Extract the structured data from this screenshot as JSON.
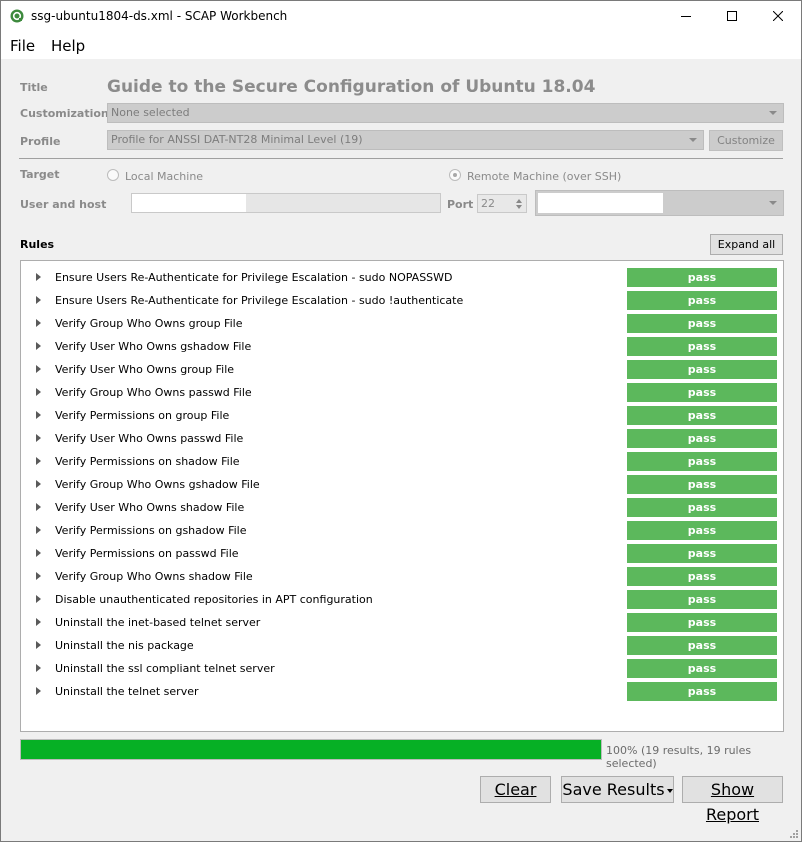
{
  "window": {
    "title": "ssg-ubuntu1804-ds.xml - SCAP Workbench"
  },
  "menu": {
    "file": "File",
    "help": "Help"
  },
  "form": {
    "title_label": "Title",
    "title_value": "Guide to the Secure Configuration of Ubuntu 18.04",
    "customization_label": "Customization",
    "customization_value": "None selected",
    "profile_label": "Profile",
    "profile_value": "Profile for ANSSI DAT-NT28 Minimal Level (19)",
    "customize_button": "Customize",
    "target_label": "Target",
    "local_machine": "Local Machine",
    "remote_machine": "Remote Machine (over SSH)",
    "user_host_label": "User and host",
    "port_label": "Port",
    "port_value": "22"
  },
  "rules": {
    "label": "Rules",
    "expand_all": "Expand all",
    "items": [
      {
        "name": "Ensure Users Re-Authenticate for Privilege Escalation - sudo NOPASSWD",
        "result": "pass"
      },
      {
        "name": "Ensure Users Re-Authenticate for Privilege Escalation - sudo !authenticate",
        "result": "pass"
      },
      {
        "name": "Verify Group Who Owns group File",
        "result": "pass"
      },
      {
        "name": "Verify User Who Owns gshadow File",
        "result": "pass"
      },
      {
        "name": "Verify User Who Owns group File",
        "result": "pass"
      },
      {
        "name": "Verify Group Who Owns passwd File",
        "result": "pass"
      },
      {
        "name": "Verify Permissions on group File",
        "result": "pass"
      },
      {
        "name": "Verify User Who Owns passwd File",
        "result": "pass"
      },
      {
        "name": "Verify Permissions on shadow File",
        "result": "pass"
      },
      {
        "name": "Verify Group Who Owns gshadow File",
        "result": "pass"
      },
      {
        "name": "Verify User Who Owns shadow File",
        "result": "pass"
      },
      {
        "name": "Verify Permissions on gshadow File",
        "result": "pass"
      },
      {
        "name": "Verify Permissions on passwd File",
        "result": "pass"
      },
      {
        "name": "Verify Group Who Owns shadow File",
        "result": "pass"
      },
      {
        "name": "Disable unauthenticated repositories in APT configuration",
        "result": "pass"
      },
      {
        "name": "Uninstall the inet-based telnet server",
        "result": "pass"
      },
      {
        "name": "Uninstall the nis package",
        "result": "pass"
      },
      {
        "name": "Uninstall the ssl compliant telnet server",
        "result": "pass"
      },
      {
        "name": "Uninstall the telnet server",
        "result": "pass"
      }
    ]
  },
  "progress": {
    "fraction": 1.0,
    "text": "100% (19 results, 19 rules selected)"
  },
  "actions": {
    "clear": "Clear",
    "save_results": "Save Results",
    "show_report": "Show Report"
  },
  "colors": {
    "pass": "#5cb85c",
    "progress": "#06b025"
  }
}
